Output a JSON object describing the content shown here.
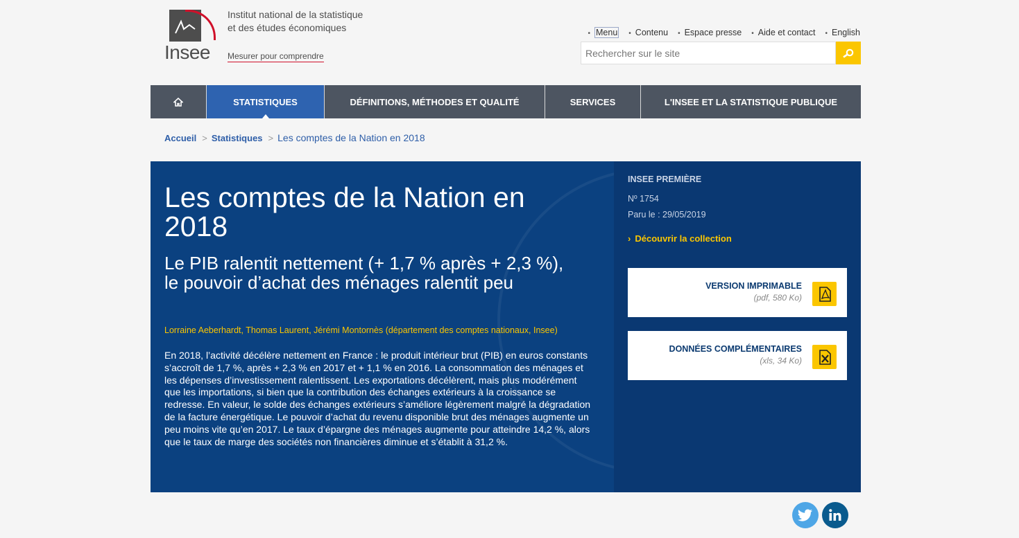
{
  "header": {
    "logo_text": "Insee",
    "institute_line1": "Institut national de la statistique",
    "institute_line2": "et des études économiques",
    "tagline": "Mesurer pour comprendre",
    "top_links": [
      "Menu",
      "Contenu",
      "Espace presse",
      "Aide et contact",
      "English"
    ],
    "search_placeholder": "Rechercher sur le site"
  },
  "nav": {
    "items": [
      "STATISTIQUES",
      "DÉFINITIONS, MÉTHODES ET QUALITÉ",
      "SERVICES",
      "L'INSEE ET LA STATISTIQUE PUBLIQUE"
    ],
    "active": "STATISTIQUES"
  },
  "breadcrumb": [
    "Accueil",
    "Statistiques",
    "Les comptes de la Nation en 2018"
  ],
  "article": {
    "title": "Les comptes de la Nation en 2018",
    "subtitle": "Le PIB ralentit nettement (+ 1,7 % après + 2,3 %), le pouvoir d’achat des ménages ralentit peu",
    "authors": "Lorraine Aeberhardt, Thomas Laurent, Jérémi Montornès (département des comptes nationaux, Insee)",
    "abstract": "En 2018, l’activité décélère nettement en France : le produit intérieur brut (PIB) en euros constants s’accroît de 1,7 %, après + 2,3 % en 2017 et + 1,1 % en 2016. La consommation des ménages et les dépenses d’investissement ralentissent. Les exportations décélèrent, mais plus modérément que les importations, si bien que la contribution des échanges extérieurs à la croissance se redresse. En valeur, le solde des échanges extérieurs s’améliore légèrement malgré la dégradation de la facture énergétique. Le pouvoir d’achat du revenu disponible brut des ménages augmente un peu moins vite qu’en 2017. Le taux d’épargne des ménages augmente pour atteindre 14,2 %, alors que le taux de marge des sociétés non financières diminue et s’établit à 31,2 %."
  },
  "sidebar": {
    "collection": "INSEE PREMIÈRE",
    "number": "Nº 1754",
    "published": "Paru le : 29/05/2019",
    "discover": "Découvrir la collection",
    "downloads": [
      {
        "title": "VERSION IMPRIMABLE",
        "info": "(pdf, 580 Ko)",
        "icon": "pdf-icon"
      },
      {
        "title": "DONNÉES COMPLÉMENTAIRES",
        "info": "(xls, 34 Ko)",
        "icon": "xls-icon"
      }
    ]
  },
  "social": [
    "twitter-icon",
    "linkedin-icon"
  ],
  "colors": {
    "nav_bg": "#4d5561",
    "nav_active": "#2e63b0",
    "panel_bg": "#0b4180",
    "accent_yellow": "#fbc600"
  }
}
